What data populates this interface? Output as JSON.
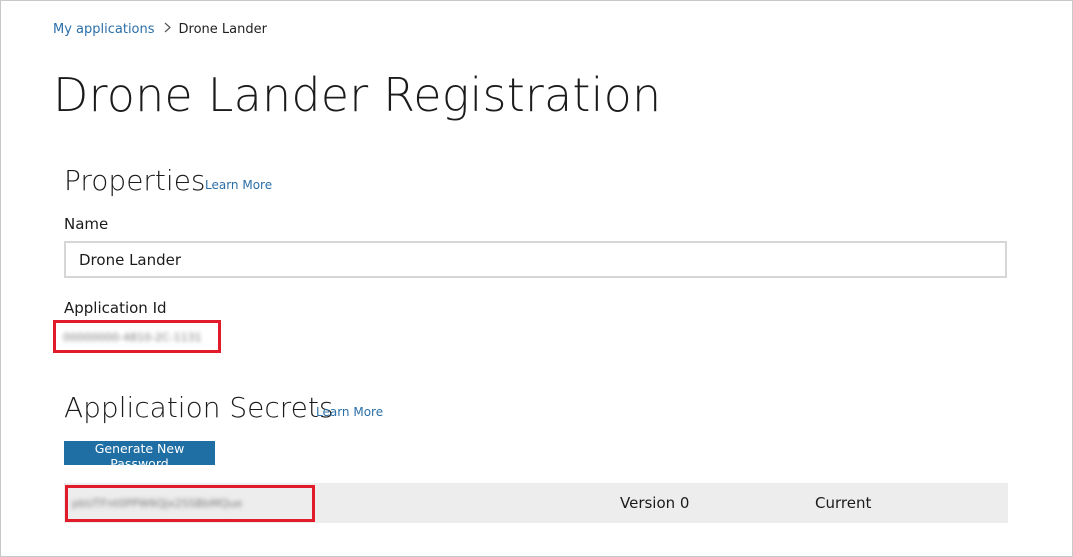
{
  "breadcrumb": {
    "parent": "My applications",
    "current": "Drone Lander"
  },
  "page": {
    "title": "Drone Lander Registration"
  },
  "properties": {
    "title": "Properties",
    "learn_more": "Learn More",
    "name_label": "Name",
    "name_value": "Drone Lander",
    "app_id_label": "Application Id",
    "app_id_value": "00000000-4810-2C-1131"
  },
  "secrets": {
    "title": "Application Secrets",
    "learn_more": "Learn More",
    "generate_button": "Generate New Password",
    "rows": [
      {
        "secret": "pbUTFnt0PPW6Qjx2SSBbMQue",
        "version": "Version 0",
        "status": "Current"
      }
    ]
  },
  "colors": {
    "link": "#2b6fa8",
    "button": "#1f6fa5",
    "highlight": "#e21b2a",
    "row_bg": "#ededed"
  }
}
